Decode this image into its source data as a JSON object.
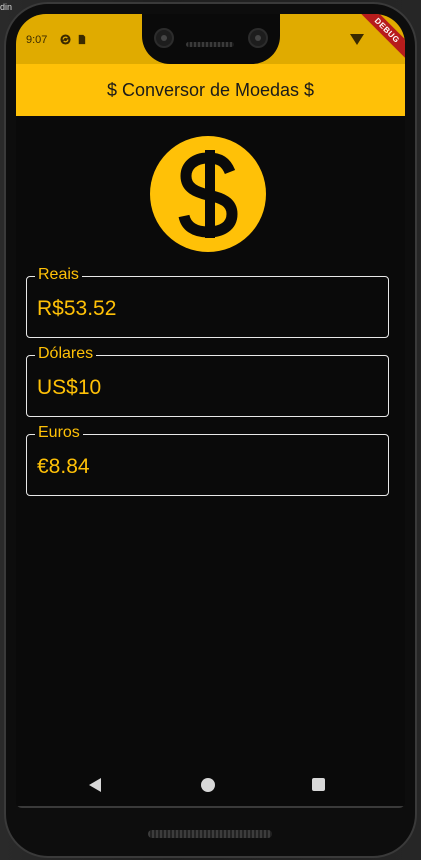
{
  "host": {
    "corner_text": "din"
  },
  "status_bar": {
    "time": "9:07",
    "icons": [
      "sync-icon",
      "sim-card-icon",
      "wifi-icon"
    ],
    "color": "#e0ab00"
  },
  "debug_banner": {
    "label": "DEBUG"
  },
  "app_bar": {
    "title": "$ Conversor de Moedas $",
    "color": "#ffc107"
  },
  "hero_icon": "dollar-coin-icon",
  "fields": [
    {
      "label": "Reais",
      "value": "R$53.52"
    },
    {
      "label": "Dólares",
      "value": "US$10"
    },
    {
      "label": "Euros",
      "value": "€8.84"
    }
  ],
  "nav_bar": {
    "icons": [
      "back-icon",
      "home-icon",
      "recents-icon"
    ]
  },
  "colors": {
    "accent": "#ffc107",
    "background": "#0a0a0a",
    "field_border": "#e8e8e8"
  }
}
